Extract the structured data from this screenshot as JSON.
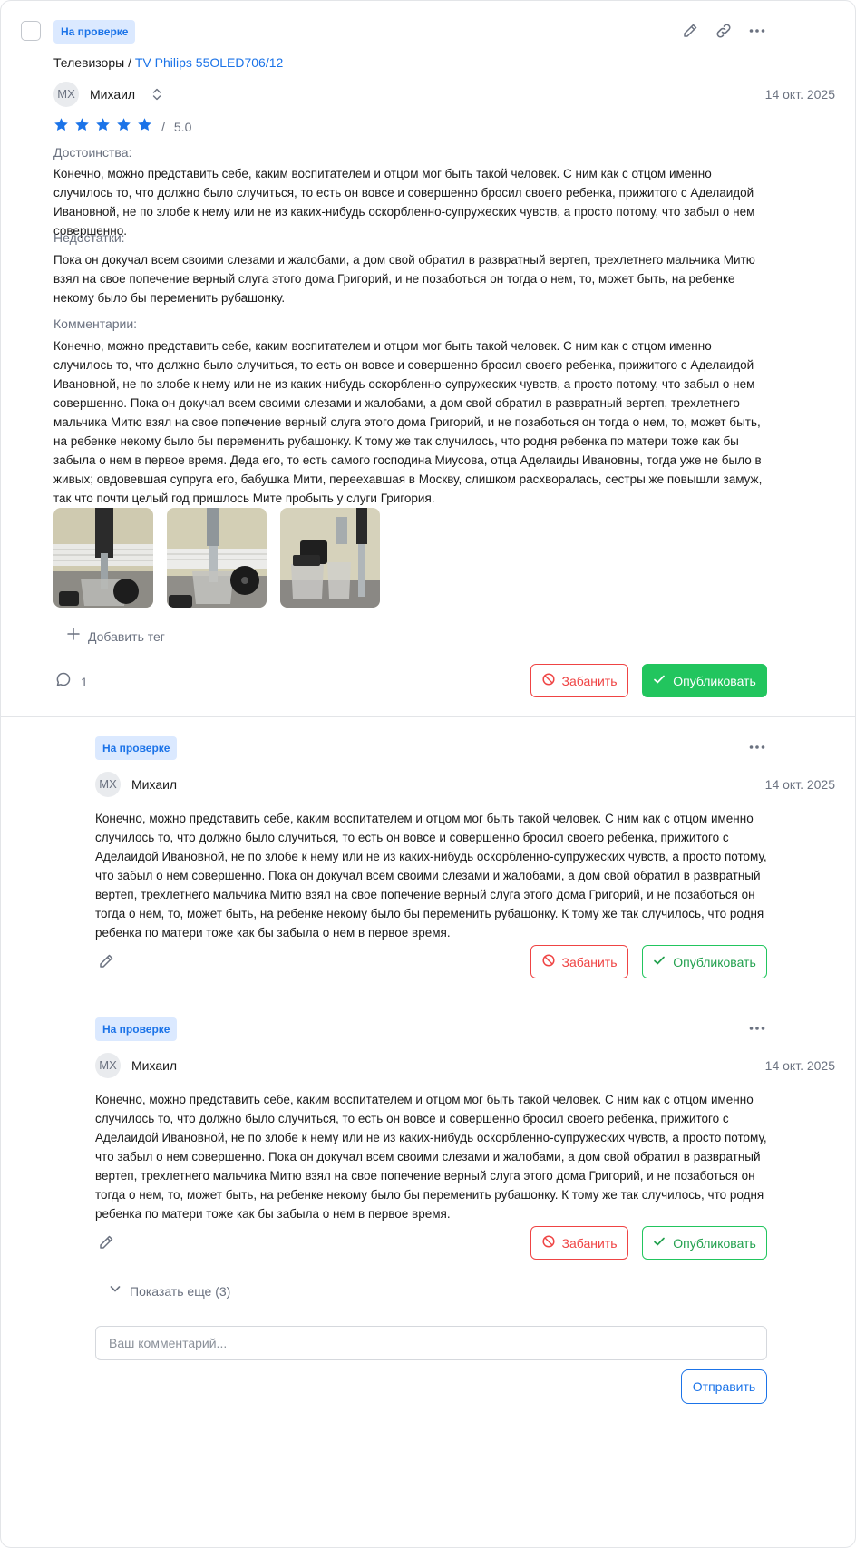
{
  "review": {
    "status": "На проверке",
    "breadcrumb_category": "Телевизоры",
    "breadcrumb_separator": " / ",
    "breadcrumb_product": "TV Philips 55OLED706/12",
    "author_initials": "МХ",
    "author_name": "Михаил",
    "date": "14 окт. 2025",
    "rating": 5,
    "rating_separator": "/",
    "rating_text": "5.0",
    "pros_label": "Достоинства:",
    "pros_text": "Конечно, можно представить себе, каким воспитателем и отцом мог быть такой человек. С ним как с отцом именно случилось то, что должно было случиться, то есть он вовсе и совершенно бросил своего ребенка, прижитого с Аделаидой Ивановной, не по злобе к нему или не из каких-нибудь оскорбленно-супружеских чувств, а просто потому, что забыл о нем совершенно.",
    "cons_label": "Недостатки:",
    "cons_text": "Пока он докучал всем своими слезами и жалобами, а дом свой обратил в развратный вертеп, трехлетнего мальчика Митю взял на свое попечение верный слуга этого дома Григорий, и не позаботься он тогда о нем, то, может быть, на ребенке некому было бы переменить рубашонку.",
    "comments_label": "Комментарии:",
    "comments_text": "Конечно, можно представить себе, каким воспитателем и отцом мог быть такой человек. С ним как с отцом именно случилось то, что должно было случиться, то есть он вовсе и совершенно бросил своего ребенка, прижитого с Аделаидой Ивановной, не по злобе к нему или не из каких-нибудь оскорбленно-супружеских чувств, а просто потому, что забыл о нем совершенно. Пока он докучал всем своими слезами и жалобами, а дом свой обратил в развратный вертеп, трехлетнего мальчика Митю взял на свое попечение верный слуга этого дома Григорий, и не позаботься он тогда о нем, то, может быть, на ребенке некому было бы переменить рубашонку. К тому же так случилось, что родня ребенка по матери тоже как бы забыла о нем в первое время. Деда его, то есть самого господина Миусова, отца Аделаиды Ивановны, тогда уже не было в живых; овдовевшая супруга его, бабушка Мити, переехавшая в Москву, слишком расхворалась, сестры же повышли замуж, так что почти целый год пришлось Мите пробыть у слуги Григория.",
    "add_tag": "Добавить тег",
    "comment_count": "1",
    "ban_label": "Забанить",
    "publish_label": "Опубликовать"
  },
  "replies": [
    {
      "status": "На проверке",
      "author_initials": "МХ",
      "author_name": "Михаил",
      "date": "14 окт. 2025",
      "text": "Конечно, можно представить себе, каким воспитателем и отцом мог быть такой человек. С ним как с отцом именно случилось то, что должно было случиться, то есть он вовсе и совершенно бросил своего ребенка, прижитого с Аделаидой Ивановной, не по злобе к нему или не из каких-нибудь оскорбленно-супружеских чувств, а просто потому, что забыл о нем совершенно. Пока он докучал всем своими слезами и жалобами, а дом свой обратил в развратный вертеп, трехлетнего мальчика Митю взял на свое попечение верный слуга этого дома Григорий, и не позаботься он тогда о нем, то, может быть, на ребенке некому было бы переменить рубашонку. К тому же так случилось, что родня ребенка по матери тоже как бы забыла о нем в первое время.",
      "ban_label": "Забанить",
      "publish_label": "Опубликовать"
    },
    {
      "status": "На проверке",
      "author_initials": "МХ",
      "author_name": "Михаил",
      "date": "14 окт. 2025",
      "text": "Конечно, можно представить себе, каким воспитателем и отцом мог быть такой человек. С ним как с отцом именно случилось то, что должно было случиться, то есть он вовсе и совершенно бросил своего ребенка, прижитого с Аделаидой Ивановной, не по злобе к нему или не из каких-нибудь оскорбленно-супружеских чувств, а просто потому, что забыл о нем совершенно. Пока он докучал всем своими слезами и жалобами, а дом свой обратил в развратный вертеп, трехлетнего мальчика Митю взял на свое попечение верный слуга этого дома Григорий, и не позаботься он тогда о нем, то, может быть, на ребенке некому было бы переменить рубашонку. К тому же так случилось, что родня ребенка по матери тоже как бы забыла о нем в первое время.",
      "ban_label": "Забанить",
      "publish_label": "Опубликовать"
    }
  ],
  "show_more": "Показать еще (3)",
  "comment_form": {
    "placeholder": "Ваш комментарий...",
    "submit_label": "Отправить"
  },
  "colors": {
    "accent": "#1b73e8",
    "star": "#1b73e8",
    "ban": "#ef4444",
    "publish": "#22c55e",
    "badge_bg": "#dbe9ff"
  }
}
